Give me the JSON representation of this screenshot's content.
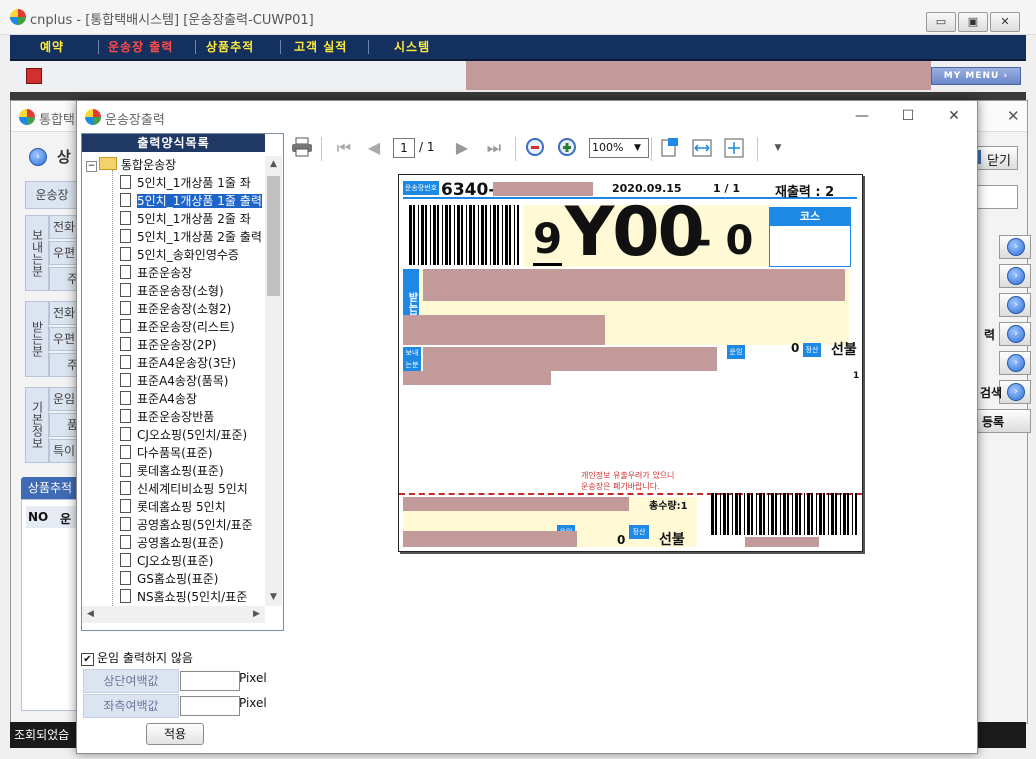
{
  "app": {
    "title": "cnplus - [통합택배시스템] [운송장출력-CUWP01]",
    "window_buttons": [
      "▭",
      "▣",
      "✕"
    ],
    "menu": [
      "예약",
      "운송장 출력",
      "상품추적",
      "고객 실적",
      "시스템"
    ],
    "my_menu": "MY MENU ›",
    "child_title": "통합택",
    "child_close": "닫기",
    "child_labels": {
      "section1": "상",
      "waybill": "운송장",
      "sender_group": "보내는분",
      "phone1": "전화",
      "zip1": "우편",
      "addr1": "주",
      "receiver_group": "받는분",
      "phone2": "전화",
      "zip2": "우편",
      "addr2": "주",
      "basic_group": "기본정보",
      "fare": "운임",
      "item": "품",
      "special": "특이",
      "tracking_tab": "상품추적",
      "col_no": "NO",
      "col_un": "운"
    },
    "right_buttons": [
      "력",
      "검색",
      "등록"
    ],
    "status_text": "조회되었습"
  },
  "dialog": {
    "title": "운송장출력",
    "caption_buttons": [
      "—",
      "☐",
      "✕"
    ],
    "tree_header": "출력양식목록",
    "tree_root": "통합운송장",
    "tree_items": [
      "5인치_1개상품 1줄 좌",
      "5인치_1개상품 1줄 출력",
      "5인치_1개상품 2줄 좌",
      "5인치_1개상품 2줄 출력",
      "5인치_송화인영수증",
      "표준운송장",
      "표준운송장(소형)",
      "표준운송장(소형2)",
      "표준운송장(리스트)",
      "표준운송장(2P)",
      "표준A4운송장(3단)",
      "표준A4송장(품목)",
      "표준A4송장",
      "표준운송장반품",
      "CJ오쇼핑(5인치/표준)",
      "다수품목(표준)",
      "롯데홈쇼핑(표준)",
      "신세계티비쇼핑 5인치",
      "롯데홈쇼핑 5인치",
      "공영홈쇼핑(5인치/표준",
      "공영홈쇼핑(표준)",
      "CJ오쇼핑(표준)",
      "GS홈쇼핑(표준)",
      "NS홈쇼핑(5인치/표준"
    ],
    "selected_index": 1,
    "no_fare_checkbox": "운임 출력하지 않음",
    "no_fare_checked": "✔",
    "top_margin_label": "상단여백값",
    "left_margin_label": "좌측여백값",
    "pixel_unit": "Pixel",
    "apply_label": "적용"
  },
  "viewer": {
    "page_current": "1",
    "page_total": "/ 1",
    "zoom": "100%",
    "icons": [
      "print-icon",
      "first-page-icon",
      "prev-page-icon",
      "next-page-icon",
      "last-page-icon",
      "zoom-out-icon",
      "zoom-in-icon",
      "page-setup-icon",
      "fit-width-icon",
      "fit-page-icon",
      "dropdown-icon"
    ]
  },
  "label": {
    "waybill_prefix_label": "운송장번호",
    "waybill_no": "6340-",
    "date": "2020.09.15",
    "page": "1 / 1",
    "reprint": "재출력 : 2",
    "big_left": "9",
    "big_code": "Y00",
    "big_right": "- 0",
    "course": "코스",
    "receiver_tag": "받는분",
    "sender_tag": "보내는분",
    "tag_fare": "운임",
    "fare_value1": "0",
    "tag_settle": "정산",
    "prepaid1": "선불",
    "qty_mark": "1",
    "privacy_line1": "개인정보 유출우려가 있으니",
    "privacy_line2": "운송장은 폐기바랍니다.",
    "total_qty": "총수량:1",
    "tag_fare2": "운임",
    "tag_settle2": "정산",
    "fare_value2": "0",
    "prepaid2": "선불"
  }
}
